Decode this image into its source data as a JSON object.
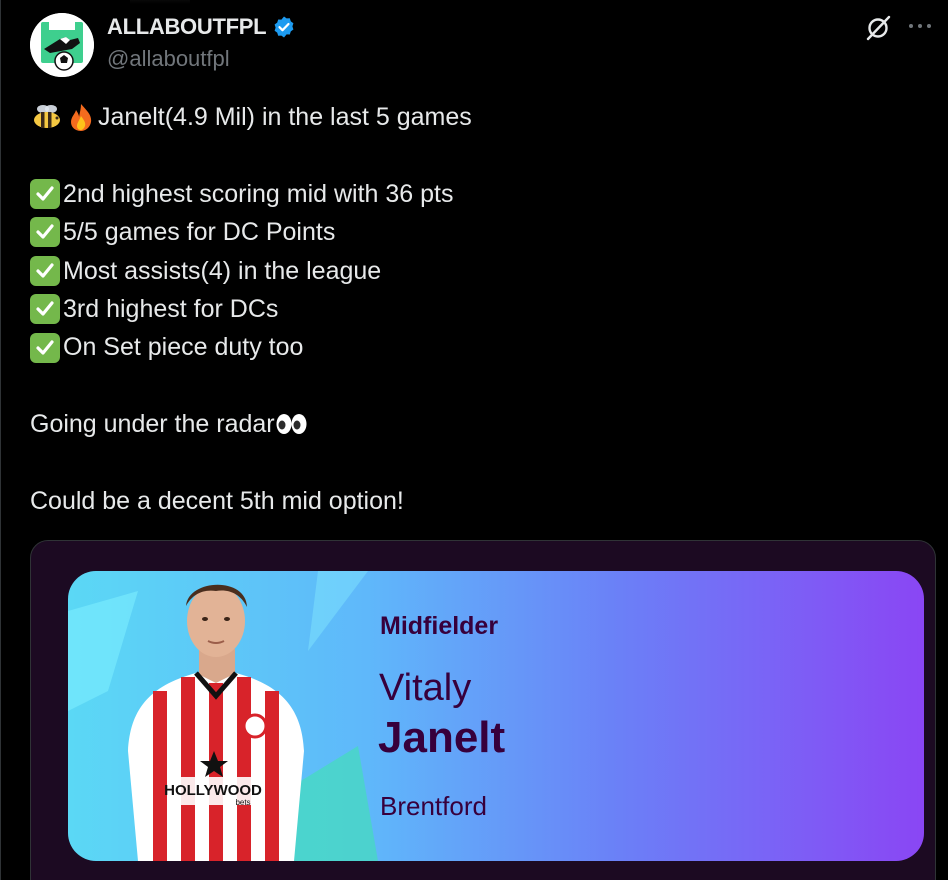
{
  "author": {
    "display_name": "ALLABOUTFPL",
    "handle": "@allaboutfpl",
    "verified": true
  },
  "icons": {
    "avatar": "football-boot-logo",
    "verified": "verified-badge-icon",
    "grok": "grok-icon",
    "more": "more-options-icon",
    "check": "check-mark-button-emoji",
    "bee": "bee-emoji",
    "fire": "fire-emoji",
    "eyes": "eyes-emoji"
  },
  "tweet": {
    "line1": "Janelt(4.9 Mil) in the last 5 games",
    "points": [
      "2nd highest scoring mid with 36 pts",
      "5/5 games for DC Points",
      "Most assists(4) in the league",
      "3rd highest for DCs",
      "On Set piece duty too"
    ],
    "line_radar": "Going under the radar",
    "line_last": "Could be a decent 5th mid option!"
  },
  "card": {
    "position": "Midfielder",
    "first_name": "Vitaly",
    "last_name": "Janelt",
    "club": "Brentford",
    "sponsor": "HOLLYWOOD",
    "sponsor_sub": "bets"
  },
  "colors": {
    "background": "#000000",
    "text": "#e7e9ea",
    "secondary_text": "#71767b",
    "verified": "#1d9bf0",
    "check_emoji": "#74b84b",
    "card_text": "#37003c"
  }
}
